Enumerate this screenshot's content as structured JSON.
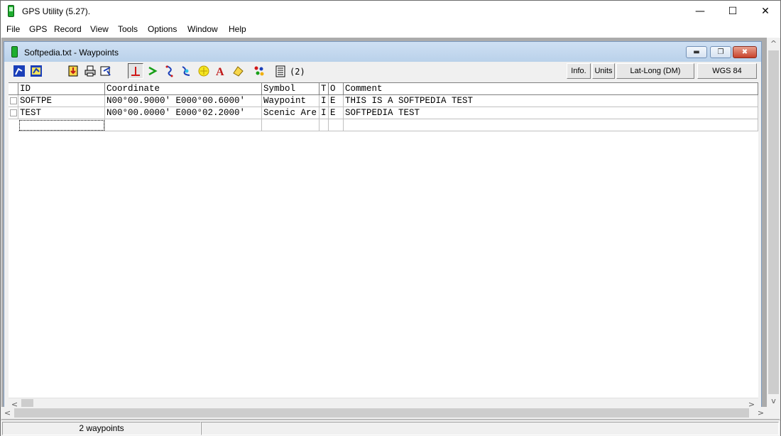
{
  "window": {
    "title": "GPS Utility (5.27).",
    "controls": {
      "minimize": "—",
      "maximize": "☐",
      "close": "✕"
    }
  },
  "menu": [
    "File",
    "GPS",
    "Record",
    "View",
    "Tools",
    "Options",
    "Window",
    "Help"
  ],
  "child_window": {
    "title": "Softpedia.txt - Waypoints",
    "controls": {
      "minimize": "▬",
      "restore": "❐",
      "close": "✖"
    }
  },
  "toolbar": {
    "record_count": "(2)",
    "info_label": "Info.",
    "units_label": "Units",
    "coord_format": "Lat-Long (DM)",
    "datum": "WGS 84",
    "icons": [
      "select-waypoints-icon",
      "select-routes-icon",
      "import-icon",
      "print-icon",
      "settings-icon",
      "waypoint-mode-icon",
      "route-mode-icon",
      "track-mode-icon",
      "map-icon",
      "position-icon",
      "text-icon",
      "note-icon",
      "symbol-icon",
      "list-icon"
    ]
  },
  "grid": {
    "columns": [
      "ID",
      "Coordinate",
      "Symbol",
      "T",
      "O",
      "Comment"
    ],
    "rows": [
      {
        "id": "SOFTPE",
        "coord": "N00°00.9000' E000°00.6000'",
        "symbol": "Waypoint",
        "t": "I",
        "o": "E",
        "comment": "THIS IS A SOFTPEDIA TEST"
      },
      {
        "id": "TEST",
        "coord": "N00°00.0000' E000°02.2000'",
        "symbol": "Scenic Are",
        "t": "I",
        "o": "E",
        "comment": "SOFTPEDIA TEST"
      }
    ]
  },
  "status": {
    "text": "2 waypoints"
  },
  "colors": {
    "title_gradient_top": "#cfe0f3",
    "title_gradient_bottom": "#b9d1ea",
    "mdi_background": "#ababab"
  }
}
